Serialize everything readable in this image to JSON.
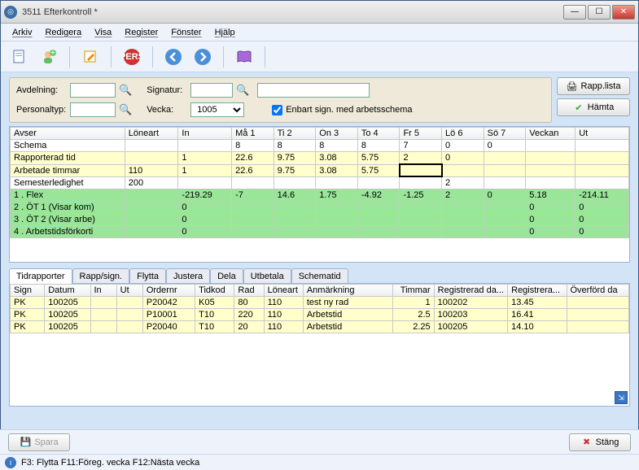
{
  "window": {
    "title": "3511 Efterkontroll *"
  },
  "menu": {
    "items": [
      "Arkiv",
      "Redigera",
      "Visa",
      "Register",
      "Fönster",
      "Hjälp"
    ]
  },
  "filters": {
    "avdelning_label": "Avdelning:",
    "signatur_label": "Signatur:",
    "personaltyp_label": "Personaltyp:",
    "vecka_label": "Vecka:",
    "vecka_value": "1005",
    "chk_label": "Enbart sign. med arbetsschema",
    "btn_rapplista": "Rapp.lista",
    "btn_hamta": "Hämta"
  },
  "grid1": {
    "headers": [
      "Avser",
      "Löneart",
      "In",
      "Må 1",
      "Ti 2",
      "On 3",
      "To 4",
      "Fr 5",
      "Lö 6",
      "Sö 7",
      "Veckan",
      "Ut"
    ],
    "rows": [
      {
        "cls": "",
        "cells": [
          "Schema",
          "",
          "",
          "8",
          "8",
          "8",
          "8",
          "7",
          "0",
          "0",
          "",
          ""
        ]
      },
      {
        "cls": "yellow",
        "cells": [
          "Rapporterad tid",
          "",
          "1",
          "22.6",
          "9.75",
          "3.08",
          "5.75",
          "2",
          "0",
          "",
          "",
          ""
        ]
      },
      {
        "cls": "yellow",
        "cells": [
          "Arbetade timmar",
          "110",
          "1",
          "22.6",
          "9.75",
          "3.08",
          "5.75",
          "",
          "",
          "",
          "",
          ""
        ],
        "sel": 7
      },
      {
        "cls": "",
        "cells": [
          "Semesterledighet",
          "200",
          "",
          "",
          "",
          "",
          "",
          "",
          "2",
          "",
          "",
          ""
        ]
      },
      {
        "cls": "green",
        "cells": [
          "1 . Flex",
          "",
          "-219.29",
          "-7",
          "14.6",
          "1.75",
          "-4.92",
          "-1.25",
          "2",
          "0",
          "5.18",
          "-214.11"
        ]
      },
      {
        "cls": "green",
        "cells": [
          "2 . ÖT 1 (Visar kom)",
          "",
          "0",
          "",
          "",
          "",
          "",
          "",
          "",
          "",
          "0",
          "0"
        ]
      },
      {
        "cls": "green",
        "cells": [
          "3 . ÖT 2 (Visar arbe)",
          "",
          "0",
          "",
          "",
          "",
          "",
          "",
          "",
          "",
          "0",
          "0"
        ]
      },
      {
        "cls": "green",
        "cells": [
          "4 . Arbetstidsförkorti",
          "",
          "0",
          "",
          "",
          "",
          "",
          "",
          "",
          "",
          "0",
          "0"
        ]
      }
    ]
  },
  "tabs": {
    "items": [
      "Tidrapporter",
      "Rapp/sign.",
      "Flytta",
      "Justera",
      "Dela",
      "Utbetala",
      "Schematid"
    ],
    "active": 0
  },
  "grid2": {
    "headers": [
      "Sign",
      "Datum",
      "In",
      "Ut",
      "Ordernr",
      "Tidkod",
      "Rad",
      "Löneart",
      "Anmärkning",
      "Timmar",
      "Registrerad da...",
      "Registrera...",
      "Överförd da"
    ],
    "rows": [
      [
        "PK",
        "100205",
        "",
        "",
        "P20042",
        "K05",
        "80",
        "110",
        "test ny rad",
        "1",
        "100202",
        "13.45",
        ""
      ],
      [
        "PK",
        "100205",
        "",
        "",
        "P10001",
        "T10",
        "220",
        "110",
        "Arbetstid",
        "2.5",
        "100203",
        "16.41",
        ""
      ],
      [
        "PK",
        "100205",
        "",
        "",
        "P20040",
        "T10",
        "20",
        "110",
        "Arbetstid",
        "2.25",
        "100205",
        "14.10",
        ""
      ]
    ]
  },
  "bottom": {
    "spara": "Spara",
    "stang": "Stäng"
  },
  "status": {
    "text": "F3: Flytta  F11:Föreg. vecka  F12:Nästa vecka"
  }
}
